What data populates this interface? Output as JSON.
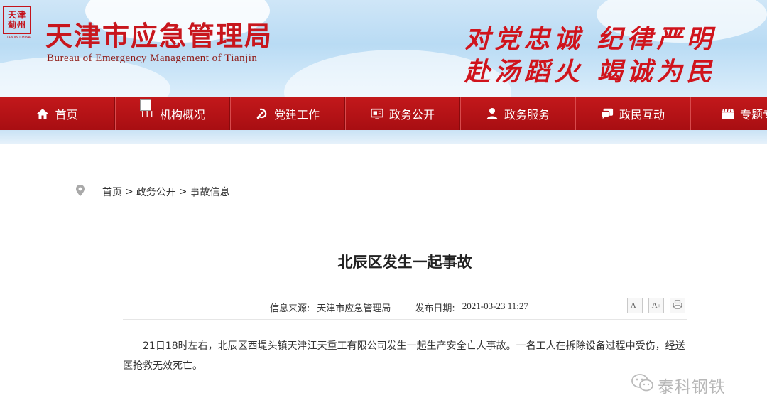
{
  "header": {
    "emblem_text": "天津蓟州",
    "emblem_sub": "TIANJIN CHINA",
    "title": "天津市应急管理局",
    "subtitle": "Bureau of Emergency Management of Tianjin",
    "slogan_line1": "对党忠诚 纪律严明",
    "slogan_line2": "赴汤蹈火 竭诚为民"
  },
  "nav": {
    "items": [
      {
        "label": "首页",
        "icon": "home-icon"
      },
      {
        "label": "机构概况",
        "icon": "broken-image",
        "alt": "111"
      },
      {
        "label": "党建工作",
        "icon": "party-emblem-icon"
      },
      {
        "label": "政务公开",
        "icon": "screen-icon"
      },
      {
        "label": "政务服务",
        "icon": "person-icon"
      },
      {
        "label": "政民互动",
        "icon": "chat-icon"
      },
      {
        "label": "专题专",
        "icon": "clapper-icon"
      }
    ]
  },
  "breadcrumb": {
    "items": [
      "首页",
      "政务公开",
      "事故信息"
    ],
    "separator": ">"
  },
  "article": {
    "title": "北辰区发生一起事故",
    "source_label": "信息来源:",
    "source_value": "天津市应急管理局",
    "date_label": "发布日期:",
    "date_value": "2021-03-23 11:27",
    "font_smaller": "A",
    "font_larger": "A",
    "body": "21日18时左右，北辰区西堤头镇天津江天重工有限公司发生一起生产安全亡人事故。一名工人在拆除设备过程中受伤，经送医抢救无效死亡。"
  },
  "watermark": {
    "text": "泰科钢铁"
  },
  "colors": {
    "brand_red": "#c8161d",
    "nav_red": "#b3121a",
    "sky": "#b9dbf4"
  }
}
